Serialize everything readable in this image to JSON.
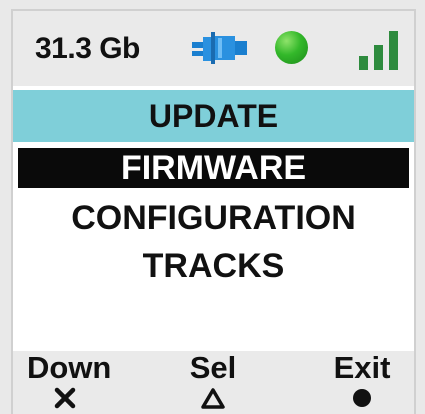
{
  "status": {
    "storage": "31.3 Gb",
    "plug_icon": "power-plug-icon",
    "status_icon": "green-status-dot-icon",
    "signal_icon": "signal-strength-icon",
    "status_color": "#33b82a"
  },
  "title": "UPDATE",
  "title_color": "#7fcfd9",
  "menu": {
    "items": [
      {
        "label": "FIRMWARE",
        "selected": true
      },
      {
        "label": "CONFIGURATION",
        "selected": false
      },
      {
        "label": "TRACKS",
        "selected": false
      }
    ]
  },
  "softkeys": {
    "down": {
      "label": "Down",
      "icon": "cross-icon"
    },
    "sel": {
      "label": "Sel",
      "icon": "triangle-icon"
    },
    "exit": {
      "label": "Exit",
      "icon": "circle-icon"
    }
  }
}
